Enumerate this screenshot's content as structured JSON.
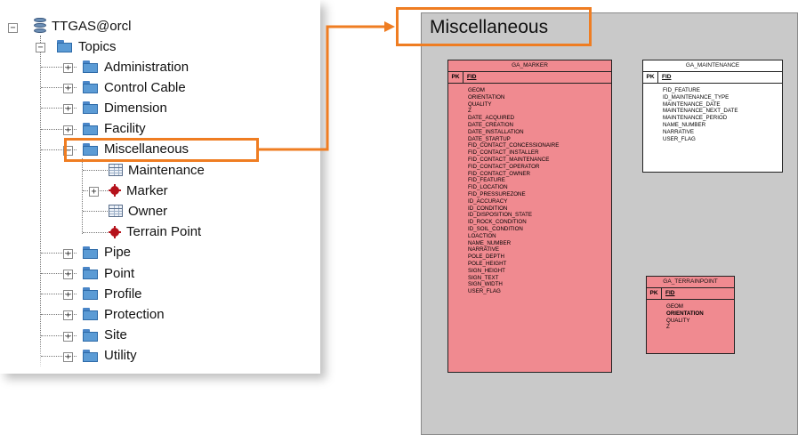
{
  "tree": {
    "root_label": "TTGAS@orcl",
    "topics_label": "Topics",
    "items": [
      {
        "label": "Administration"
      },
      {
        "label": "Control Cable"
      },
      {
        "label": "Dimension"
      },
      {
        "label": "Facility"
      },
      {
        "label": "Miscellaneous"
      },
      {
        "label": "Pipe"
      },
      {
        "label": "Point"
      },
      {
        "label": "Profile"
      },
      {
        "label": "Protection"
      },
      {
        "label": "Site"
      },
      {
        "label": "Utility"
      }
    ],
    "misc_children": [
      {
        "label": "Maintenance",
        "icon": "table-icon"
      },
      {
        "label": "Marker",
        "icon": "point-icon"
      },
      {
        "label": "Owner",
        "icon": "table-icon"
      },
      {
        "label": "Terrain Point",
        "icon": "point-icon"
      }
    ]
  },
  "diagram": {
    "title": "Miscellaneous",
    "entities": {
      "marker": {
        "name": "GA_MARKER",
        "pk_label": "PK",
        "pk_field": "FID",
        "attributes": [
          "GEOM",
          "ORIENTATION",
          "QUALITY",
          "Z",
          "DATE_ACQUIRED",
          "DATE_CREATION",
          "DATE_INSTALLATION",
          "DATE_STARTUP",
          "FID_CONTACT_CONCESSIONAIRE",
          "FID_CONTACT_INSTALLER",
          "FID_CONTACT_MAINTENANCE",
          "FID_CONTACT_OPERATOR",
          "FID_CONTACT_OWNER",
          "FID_FEATURE",
          "FID_LOCATION",
          "FID_PRESSUREZONE",
          "ID_ACCURACY",
          "ID_CONDITION",
          "ID_DISPOSITION_STATE",
          "ID_ROCK_CONDITION",
          "ID_SOIL_CONDITION",
          "LOACTION",
          "NAME_NUMBER",
          "NARRATIVE",
          "POLE_DEPTH",
          "POLE_HEIGHT",
          "SIGN_HEIGHT",
          "SIGN_TEXT",
          "SIGN_WIDTH",
          "USER_FLAG"
        ]
      },
      "maintenance": {
        "name": "GA_MAINTENANCE",
        "pk_label": "PK",
        "pk_field": "FID",
        "attributes": [
          "FID_FEATURE",
          "ID_MAINTENANCE_TYPE",
          "MAINTENANCE_DATE",
          "MAINTENANCE_NEXT_DATE",
          "MAINTENANCE_PERIOD",
          "NAME_NUMBER",
          "NARRATIVE",
          "USER_FLAG"
        ]
      },
      "terrainpoint": {
        "name": "GA_TERRAINPOINT",
        "pk_label": "PK",
        "pk_field": "FID",
        "attributes": [
          "GEOM",
          "ORIENTATION",
          "QUALITY",
          "Z"
        ]
      }
    }
  },
  "colors": {
    "highlight": "#ef7d22",
    "entity_red": "#f08a90",
    "diagram_bg": "#c9c9c9",
    "folder": "#5b9bd5"
  }
}
